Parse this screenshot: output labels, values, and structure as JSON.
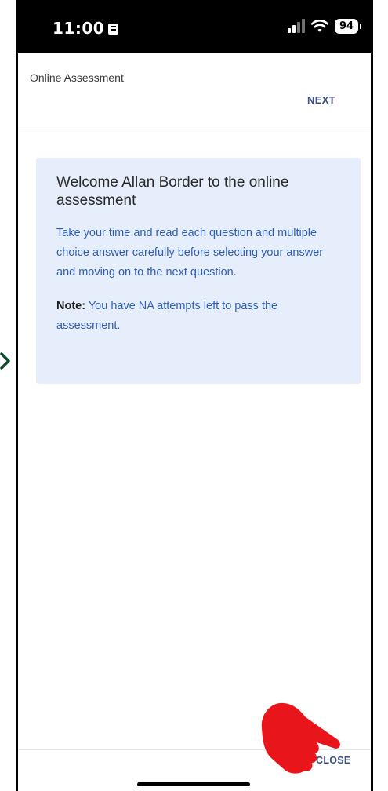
{
  "status_bar": {
    "time": "11:00",
    "battery": "94"
  },
  "header": {
    "title": "Online Assessment",
    "next_label": "NEXT"
  },
  "welcome_card": {
    "title": "Welcome Allan Border to the online assessment",
    "body": "Take your time and read each question and multiple choice answer carefully before selecting your answer and moving on to the next question.",
    "note_label": "Note:",
    "note_text": " You have NA attempts left to pass the assessment."
  },
  "footer": {
    "close_label": "CLOSE"
  },
  "icons": {
    "pointer": "hand-pointer-icon",
    "side_arrow": "chevron-right-icon"
  },
  "colors": {
    "accent": "#3d4f86",
    "card_bg": "#e6eefc",
    "body_text": "#2f5fb5",
    "pointer": "#e8161b"
  }
}
